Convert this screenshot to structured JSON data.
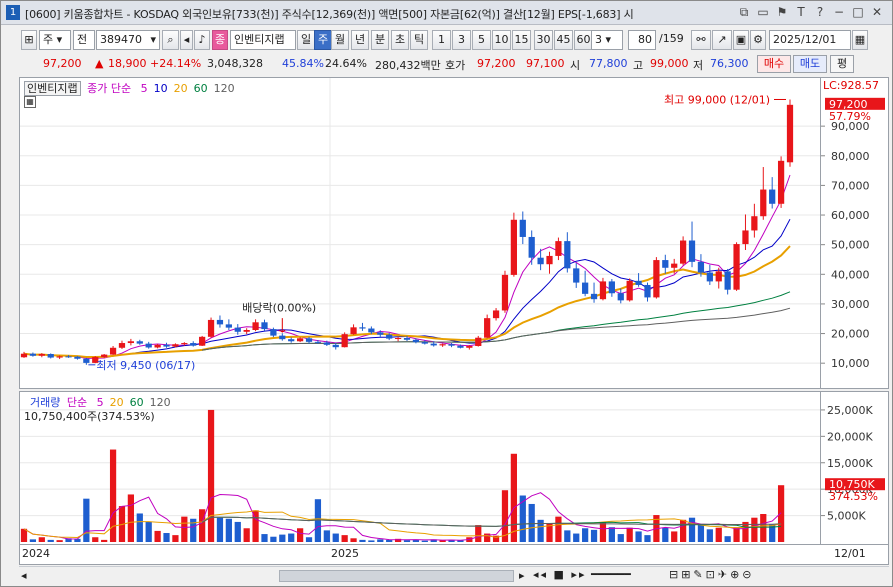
{
  "titlebar": {
    "num": "1",
    "text": "[0600] 키움종합차트 - KOSDAQ 외국인보유[733(천)] 주식수[12,369(천)] 액면[500] 자본금[62(억)] 결산[12월] EPS[-1,683] 시"
  },
  "toolbar": {
    "market": "주",
    "all": "전",
    "code": "389470",
    "tag": "종",
    "name": "인벤티지랩",
    "periods": [
      "일",
      "주",
      "월",
      "년",
      "분",
      "초",
      "틱"
    ],
    "active_period": "주",
    "nums": [
      "1",
      "3",
      "5",
      "10",
      "15",
      "30",
      "45",
      "60"
    ],
    "custom_num": "3",
    "count": "80",
    "total": "/159",
    "date": "2025/12/01"
  },
  "info": {
    "price": "97,200",
    "change": "18,900",
    "rate": "+24.14%",
    "volume": "3,048,328",
    "ratio1": "45.84%",
    "ratio2": "24.64%",
    "amount": "280,432백만",
    "bid_label": "호가",
    "bid1": "97,200",
    "bid2": "97,100",
    "open_label": "시",
    "open": "77,800",
    "high_label": "고",
    "high": "99,000",
    "low_label": "저",
    "low": "76,300",
    "buy_btn": "매수",
    "sell_btn": "매도",
    "eval_btn": "평"
  },
  "price_chart": {
    "title": "인벤티지랩",
    "ma_label": "종가 단순",
    "ma": [
      {
        "label": "5",
        "color": "#c000c0"
      },
      {
        "label": "10",
        "color": "#0000c8"
      },
      {
        "label": "20",
        "color": "#e8a000"
      },
      {
        "label": "60",
        "color": "#008040"
      },
      {
        "label": "120",
        "color": "#606060"
      }
    ],
    "lc_label": "LC:928.57",
    "price_tag": "97,200",
    "rate_tag": "57.79%",
    "high_note": "최고 99,000 (12/01)",
    "low_note": "최저 9,450 (06/17)",
    "div_note": "배당락(0.00%)",
    "yticks": [
      "90,000",
      "80,000",
      "70,000",
      "60,000",
      "50,000",
      "40,000",
      "30,000",
      "20,000",
      "10,000"
    ]
  },
  "volume_chart": {
    "title": "거래량",
    "ma_label": "단순",
    "ma": [
      {
        "label": "5",
        "color": "#c000c0"
      },
      {
        "label": "20",
        "color": "#e8a000"
      },
      {
        "label": "60",
        "color": "#008040"
      },
      {
        "label": "120",
        "color": "#606060"
      }
    ],
    "value_note": "10,750,400주(374.53%)",
    "vol_tag": "10,750K",
    "vol_rate": "374.53%",
    "yticks": [
      "25,000K",
      "20,000K",
      "15,000K",
      "10,000K",
      "5,000K"
    ]
  },
  "xaxis": {
    "labels": [
      "2024",
      "2025"
    ],
    "right_label": "12/01"
  },
  "chart_data": {
    "type": "candlestick",
    "candles": [
      [
        12000,
        13800,
        11800,
        13200
      ],
      [
        13200,
        13600,
        12200,
        12500
      ],
      [
        12500,
        13400,
        12000,
        13100
      ],
      [
        13100,
        13300,
        11600,
        11900
      ],
      [
        11900,
        12600,
        11400,
        12300
      ],
      [
        12300,
        12700,
        11800,
        12200
      ],
      [
        12200,
        12400,
        11200,
        11500
      ],
      [
        11500,
        11800,
        9450,
        10100
      ],
      [
        10100,
        12400,
        10000,
        12100
      ],
      [
        12100,
        13100,
        11800,
        12900
      ],
      [
        12900,
        15800,
        12800,
        15200
      ],
      [
        15200,
        17600,
        14800,
        16800
      ],
      [
        16800,
        18200,
        16000,
        17400
      ],
      [
        17400,
        17900,
        16200,
        16600
      ],
      [
        16600,
        17200,
        14900,
        15300
      ],
      [
        15300,
        16500,
        15000,
        16200
      ],
      [
        16200,
        16900,
        15200,
        15600
      ],
      [
        15600,
        16700,
        15300,
        16400
      ],
      [
        16400,
        17100,
        15900,
        16800
      ],
      [
        16800,
        17400,
        15600,
        15900
      ],
      [
        15900,
        19200,
        15800,
        18900
      ],
      [
        18900,
        25400,
        18600,
        24600
      ],
      [
        24600,
        26100,
        22000,
        23100
      ],
      [
        23100,
        24800,
        21200,
        22000
      ],
      [
        22000,
        23200,
        19600,
        20600
      ],
      [
        20600,
        21800,
        19800,
        21200
      ],
      [
        21200,
        24800,
        20800,
        23800
      ],
      [
        23800,
        24700,
        21000,
        21500
      ],
      [
        21500,
        22000,
        18800,
        19300
      ],
      [
        19300,
        20100,
        17600,
        18100
      ],
      [
        18100,
        18700,
        16900,
        17400
      ],
      [
        17400,
        18800,
        17100,
        18400
      ],
      [
        18400,
        18900,
        16600,
        17200
      ],
      [
        17200,
        17800,
        16500,
        17000
      ],
      [
        17000,
        17600,
        15800,
        16200
      ],
      [
        16200,
        16900,
        14600,
        15400
      ],
      [
        15400,
        20400,
        15300,
        19800
      ],
      [
        19800,
        23100,
        19600,
        22100
      ],
      [
        22100,
        23600,
        20900,
        21700
      ],
      [
        21700,
        22400,
        19800,
        20400
      ],
      [
        20400,
        21100,
        18900,
        19600
      ],
      [
        19600,
        20200,
        17800,
        18300
      ],
      [
        18300,
        18900,
        17400,
        18500
      ],
      [
        18500,
        19200,
        17500,
        17900
      ],
      [
        17900,
        18400,
        16700,
        17100
      ],
      [
        17100,
        17700,
        16300,
        16600
      ],
      [
        16600,
        17400,
        15600,
        16000
      ],
      [
        16000,
        16600,
        15500,
        16400
      ],
      [
        16400,
        16800,
        15400,
        15900
      ],
      [
        15900,
        16300,
        15000,
        15200
      ],
      [
        15200,
        16100,
        14600,
        15800
      ],
      [
        15800,
        19200,
        15600,
        18600
      ],
      [
        18600,
        26400,
        18400,
        25200
      ],
      [
        25200,
        28600,
        24400,
        27800
      ],
      [
        27800,
        41200,
        27000,
        39800
      ],
      [
        39800,
        60800,
        39200,
        58400
      ],
      [
        58400,
        61200,
        50200,
        52600
      ],
      [
        52600,
        54800,
        43200,
        45600
      ],
      [
        45600,
        48600,
        41400,
        43400
      ],
      [
        43400,
        47600,
        40200,
        46200
      ],
      [
        46200,
        52400,
        44800,
        51200
      ],
      [
        51200,
        54200,
        40600,
        42000
      ],
      [
        42000,
        43800,
        35400,
        37200
      ],
      [
        37200,
        41200,
        32600,
        33400
      ],
      [
        33400,
        37200,
        30400,
        31600
      ],
      [
        31600,
        38800,
        31200,
        37600
      ],
      [
        37600,
        38400,
        32400,
        33600
      ],
      [
        33600,
        35200,
        30200,
        31200
      ],
      [
        31200,
        38600,
        30800,
        37800
      ],
      [
        37800,
        40400,
        35800,
        36400
      ],
      [
        36400,
        37200,
        30800,
        32200
      ],
      [
        32200,
        45800,
        31800,
        44800
      ],
      [
        44800,
        46600,
        40200,
        42200
      ],
      [
        42200,
        45200,
        40200,
        43600
      ],
      [
        43600,
        52800,
        43000,
        51400
      ],
      [
        51400,
        57800,
        42400,
        44200
      ],
      [
        44200,
        46800,
        39200,
        40600
      ],
      [
        40600,
        43200,
        36400,
        37600
      ],
      [
        37600,
        42200,
        35200,
        41000
      ],
      [
        41000,
        41800,
        33200,
        34800
      ],
      [
        34800,
        50800,
        34400,
        50200
      ],
      [
        50200,
        60200,
        48200,
        54800
      ],
      [
        54800,
        63800,
        52400,
        59600
      ],
      [
        59600,
        76200,
        58400,
        68600
      ],
      [
        68600,
        72800,
        62200,
        63800
      ],
      [
        63800,
        79800,
        62400,
        78300
      ],
      [
        77800,
        99000,
        76300,
        97200
      ]
    ],
    "volume": [
      2500,
      500,
      900,
      400,
      350,
      700,
      600,
      8200,
      900,
      400,
      17500,
      6800,
      9000,
      5400,
      3800,
      2100,
      1700,
      1300,
      4800,
      4400,
      6200,
      25000,
      4600,
      4400,
      3800,
      2600,
      6000,
      1500,
      1000,
      1400,
      1600,
      2600,
      900,
      8100,
      2200,
      1600,
      1300,
      700,
      400,
      300,
      500,
      400,
      600,
      350,
      400,
      250,
      500,
      300,
      400,
      300,
      900,
      3200,
      1600,
      1200,
      9800,
      16700,
      8800,
      7200,
      4200,
      3600,
      4800,
      2200,
      1600,
      2600,
      2300,
      3700,
      2800,
      1500,
      2700,
      2000,
      1300,
      5100,
      2700,
      2000,
      4200,
      4600,
      3400,
      2400,
      2700,
      1100,
      2800,
      3800,
      4600,
      5300,
      3300,
      10750
    ],
    "ma": {
      "5": "magenta",
      "10": "blue",
      "20": "orange",
      "60": "green",
      "120": "gray"
    },
    "x_start_label": "2024",
    "x_mid_label": "2025",
    "last_date": "12/01"
  }
}
